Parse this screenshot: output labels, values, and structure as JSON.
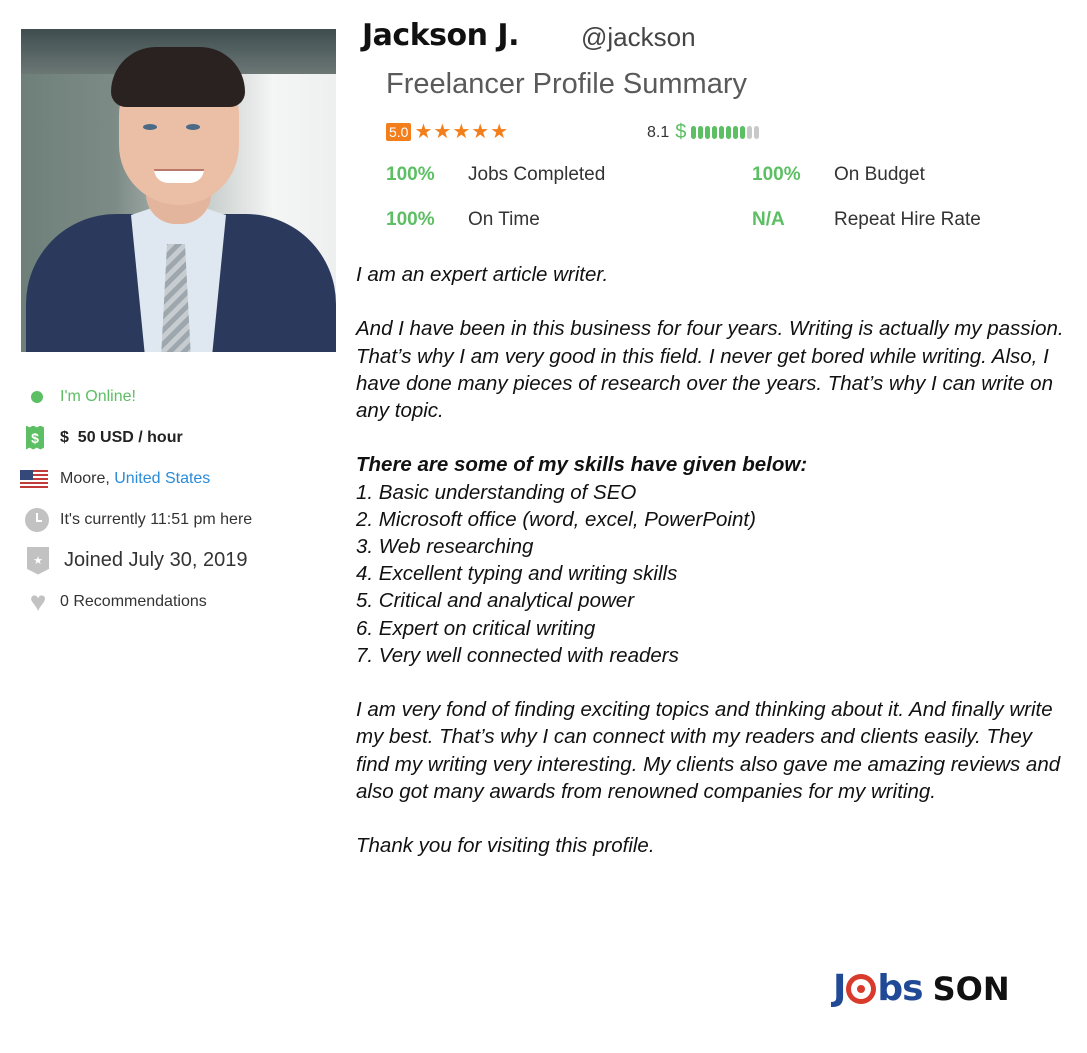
{
  "profile": {
    "name": "Jackson J.",
    "handle": "@jackson",
    "summary_title": "Freelancer Profile Summary",
    "photo_alt": "Profile photo of Jackson J."
  },
  "rating": {
    "score": "5.0",
    "stars": 5,
    "max_stars": 5,
    "accent_color": "#f37f1c"
  },
  "earnings": {
    "score": "8.1",
    "dollar_symbol": "$",
    "segments_filled": 8,
    "segments_total": 10
  },
  "stats": [
    {
      "value": "100%",
      "label": "Jobs Completed"
    },
    {
      "value": "100%",
      "label": "On Budget"
    },
    {
      "value": "100%",
      "label": "On Time"
    },
    {
      "value": "N/A",
      "label": "Repeat Hire Rate"
    }
  ],
  "info": {
    "online": "I'm Online!",
    "rate": "$  50 USD / hour",
    "city": "Moore,",
    "country": "United States",
    "local_time": "It's currently 11:51 pm here",
    "joined": "Joined July 30, 2019",
    "recommendations": "0 Recommendations"
  },
  "description": {
    "intro": "I am an expert article writer.",
    "para1": "And I have been in this business for four years. Writing is actually my passion. That’s why I am very good in this field. I never get bored while writing. Also, I have done many pieces of research over the years. That’s why I can write on any topic.",
    "skills_heading": "There are some of my skills have given below:",
    "skills": [
      "1. Basic understanding of SEO",
      "2. Microsoft office (word, excel, PowerPoint)",
      "3. Web researching",
      "4. Excellent typing and writing skills",
      "5. Critical and analytical power",
      "6. Expert on critical writing",
      "7. Very well connected with readers"
    ],
    "para2": "I am very fond of finding exciting topics and thinking about it. And finally write my best. That’s why I can connect with my readers and clients easily. They find my writing very interesting. My clients also gave me amazing reviews and also got many awards from renowned companies for my writing.",
    "closing": "Thank you for visiting this profile."
  },
  "logo": {
    "part1_a": "J",
    "part1_b": "bs",
    "part2": "SON"
  },
  "colors": {
    "green": "#5cbf63",
    "orange": "#f37f1c",
    "link_blue": "#2a8bd8",
    "logo_blue": "#214a96",
    "logo_red": "#d83a2b"
  },
  "icons": {
    "online": "online-dot-icon",
    "rate": "money-icon",
    "location": "us-flag-icon",
    "time": "clock-icon",
    "joined": "badge-star-icon",
    "recommendations": "heart-icon",
    "star": "★"
  }
}
